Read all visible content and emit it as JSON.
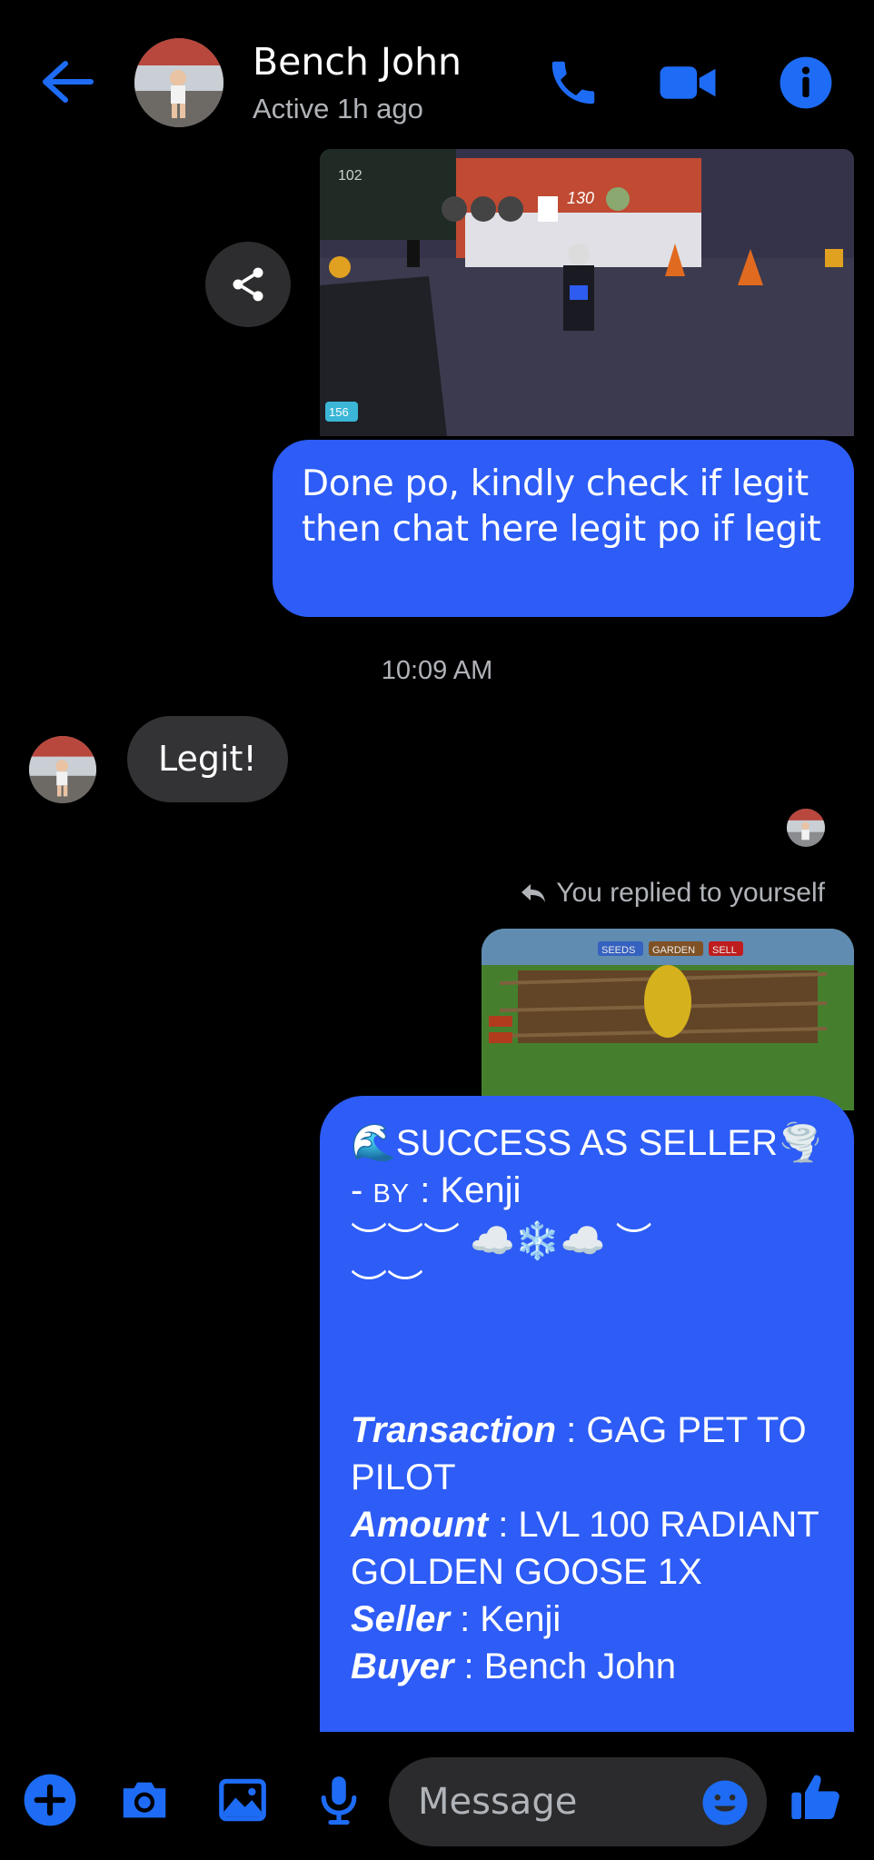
{
  "colors": {
    "accent": "#2d5cf6",
    "icon_blue": "#1e6cf5",
    "incoming_bubble": "#333336",
    "secondary_text": "#b0b3b8",
    "background": "#000000"
  },
  "header": {
    "contact_name": "Bench John",
    "status": "Active 1h ago",
    "icons": [
      "back-arrow-icon",
      "phone-icon",
      "video-camera-icon",
      "info-icon"
    ]
  },
  "conversation": {
    "outgoing_1": {
      "image": "game-screenshot",
      "image_text": [
        "102",
        "130",
        "156"
      ],
      "text": "Done po, kindly check if legit then chat here legit po if legit"
    },
    "timestamp": "10:09 AM",
    "incoming_1": {
      "text": "Legit!"
    },
    "reply_label": "You replied to yourself",
    "reply_image_text": [
      "SEEDS",
      "GARDEN",
      "SELL"
    ],
    "receipt": {
      "title": "🌊SUCCESS AS SELLER🌪️",
      "by_prefix": "- ",
      "by_label": "BY",
      "by_value": " : Kenji",
      "deco_1": "︶︶︶ ☁️❄️☁️ ︶",
      "deco_2": "︶︶",
      "transaction_label": "Transaction",
      "transaction_value": " : GAG PET TO PILOT",
      "amount_label": "Amount",
      "amount_value": " : LVL 100 RADIANT GOLDEN GOOSE 1X",
      "seller_label": "Seller",
      "seller_value": " : Kenji",
      "buyer_label": "Buyer",
      "buyer_value": " : Bench John"
    }
  },
  "composer": {
    "placeholder": "Message",
    "icons": [
      "plus-icon",
      "camera-icon",
      "gallery-icon",
      "microphone-icon",
      "emoji-icon",
      "thumbs-up-icon"
    ]
  }
}
